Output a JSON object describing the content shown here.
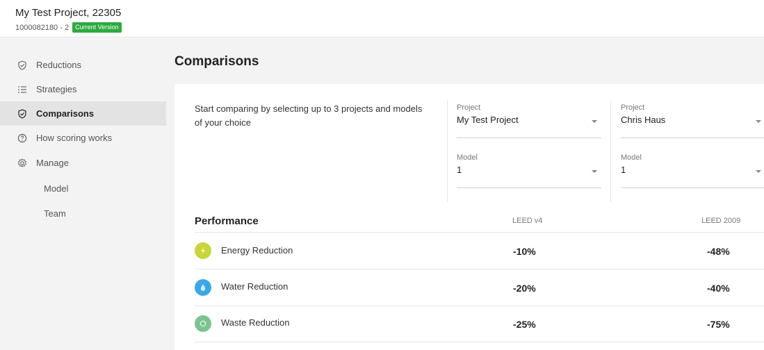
{
  "header": {
    "project_title": "My Test Project, 22305",
    "project_id": "1000082180 - 2",
    "version_badge": "Current Version"
  },
  "sidebar": {
    "items": [
      {
        "label": "Reductions",
        "icon": "shield-check-icon"
      },
      {
        "label": "Strategies",
        "icon": "list-icon"
      },
      {
        "label": "Comparisons",
        "icon": "shield-check-icon",
        "active": true
      },
      {
        "label": "How scoring works",
        "icon": "question-circle-icon"
      },
      {
        "label": "Manage",
        "icon": "gear-icon"
      }
    ],
    "sub_items": [
      "Model",
      "Team"
    ]
  },
  "main": {
    "title": "Comparisons",
    "intro": "Start comparing by selecting up to 3 projects and models of your choice",
    "selectors": [
      {
        "project_label": "Project",
        "project_value": "My Test Project",
        "model_label": "Model",
        "model_value": "1"
      },
      {
        "project_label": "Project",
        "project_value": "Chris Haus",
        "model_label": "Model",
        "model_value": "1"
      }
    ],
    "performance": {
      "title": "Performance",
      "columns": [
        "LEED v4",
        "LEED 2009"
      ],
      "rows": [
        {
          "label": "Energy Reduction",
          "icon": "lightning-icon",
          "color": "#c9d63a",
          "values": [
            "-10%",
            "-48%"
          ]
        },
        {
          "label": "Water Reduction",
          "icon": "water-drop-icon",
          "color": "#3aa8e6",
          "values": [
            "-20%",
            "-40%"
          ]
        },
        {
          "label": "Waste Reduction",
          "icon": "recycle-icon",
          "color": "#7cc48f",
          "values": [
            "-25%",
            "-75%"
          ]
        }
      ]
    }
  },
  "colors": {
    "badge": "#2eaa3f",
    "sidebar_bg": "#f3f3f3",
    "active_bg": "#e3e3e3"
  }
}
